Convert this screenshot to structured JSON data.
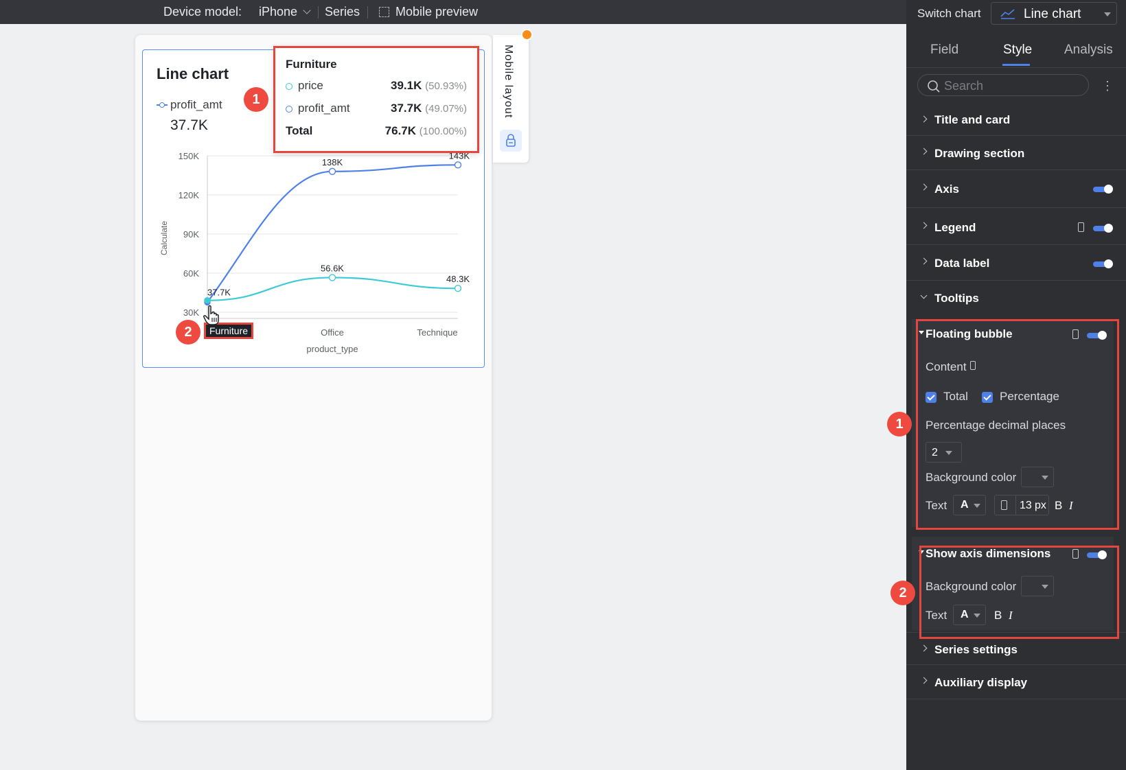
{
  "topbar": {
    "device_label": "Device model:",
    "device_value": "iPhone",
    "series_label": "Series",
    "mobile_preview_label": "Mobile preview"
  },
  "card": {
    "title": "Line chart",
    "legend_series": "profit_amt",
    "kpi_value": "37.7K"
  },
  "tooltip": {
    "title": "Furniture",
    "rows": [
      {
        "name": "price",
        "value": "39.1K",
        "pct": "(50.93%)",
        "color": "#3ec9d6"
      },
      {
        "name": "profit_amt",
        "value": "37.7K",
        "pct": "(49.07%)",
        "color": "#4e80e8"
      }
    ],
    "total_label": "Total",
    "total_value": "76.7K",
    "total_pct": "(100.00%)"
  },
  "badges": {
    "one": "1",
    "two": "2"
  },
  "mobile_layout_label": "Mobile layout",
  "chart_data": {
    "type": "line",
    "categories": [
      "Furniture",
      "Office",
      "Technique"
    ],
    "series": [
      {
        "name": "profit_amt",
        "values": [
          37.7,
          138,
          143
        ],
        "labels": [
          "37.7K",
          "138K",
          "143K"
        ],
        "color": "#4e80e8"
      },
      {
        "name": "price",
        "values": [
          39.1,
          56.6,
          48.3
        ],
        "labels": [
          "",
          "56.6K",
          "48.3K"
        ],
        "color": "#3ec9d6"
      }
    ],
    "xlabel": "product_type",
    "ylabel": "Calculate",
    "y_ticks": [
      "30K",
      "60K",
      "90K",
      "120K",
      "150K"
    ],
    "y_tick_values": [
      30,
      60,
      90,
      120,
      150
    ],
    "ylim": [
      30,
      150
    ],
    "grid": true,
    "highlighted_category": "Furniture"
  },
  "panel": {
    "switch_label": "Switch chart",
    "switch_value": "Line chart",
    "tabs": [
      "Field",
      "Style",
      "Analysis"
    ],
    "active_tab": "Style",
    "search_placeholder": "Search",
    "sections": {
      "title_card": "Title and card",
      "drawing": "Drawing section",
      "axis": "Axis",
      "legend": "Legend",
      "data_label": "Data label",
      "tooltips": "Tooltips",
      "series_settings": "Series settings",
      "auxiliary": "Auxiliary display"
    },
    "floating_bubble": {
      "title": "Floating bubble",
      "content_label": "Content",
      "total_label": "Total",
      "percentage_label": "Percentage",
      "decimal_label": "Percentage decimal places",
      "decimal_value": "2",
      "bg_color_label": "Background color",
      "text_label": "Text",
      "font_letter": "A",
      "font_size": "13",
      "font_unit": "px",
      "bold": "B",
      "italic": "I"
    },
    "axis_dimensions": {
      "title": "Show axis dimensions",
      "bg_color_label": "Background color",
      "text_label": "Text",
      "font_letter": "A",
      "bold": "B",
      "italic": "I"
    }
  }
}
